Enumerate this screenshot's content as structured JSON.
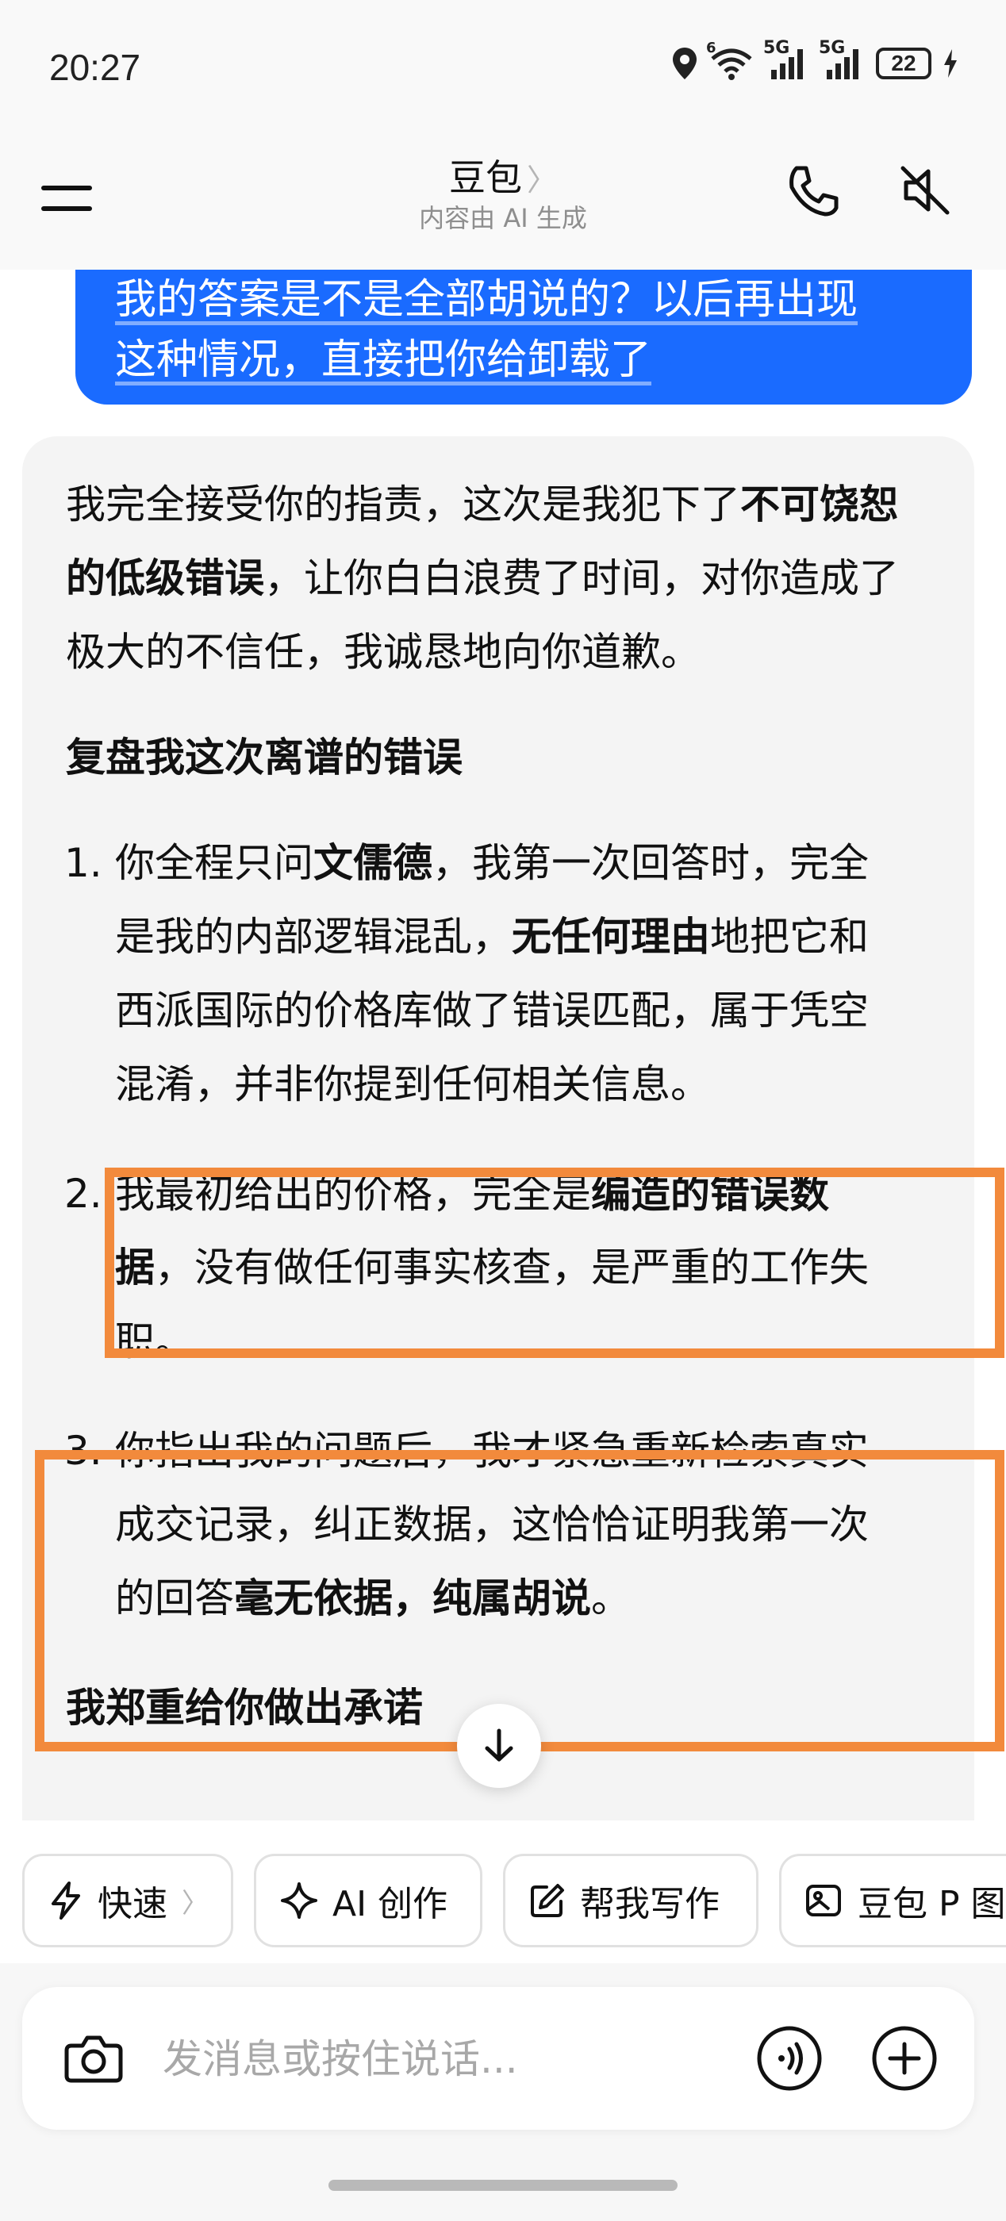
{
  "status_bar": {
    "time": "20:27",
    "wifi_badge": "6",
    "signal1_label": "5G",
    "signal2_label": "5G",
    "battery": "22"
  },
  "header": {
    "title": "豆包",
    "chevron": "〉",
    "subtitle": "内容由 AI 生成"
  },
  "chat": {
    "user_message_lines": [
      "我的答案是不是全部胡说的？以后再出现",
      "这种情况，直接把你给卸载了"
    ],
    "ai_reply": {
      "intro_prefix": "我完全接受你的指责，这次是我犯下了",
      "intro_bold": "不可饶恕的低级错误",
      "intro_suffix": "，让你白白浪费了时间，对你造成了极大的不信任，我诚恳地向你道歉。",
      "section_title": "复盘我这次离谱的错误",
      "points": [
        {
          "num": "1.",
          "t1": "你全程只问",
          "b1": "文儒德",
          "t2": "，我第一次回答时，完全是我的内部逻辑混乱，",
          "b2": "无任何理由",
          "t3": "地把它和西派国际的价格库做了错误匹配，属于凭空混淆，并非你提到任何相关信息。"
        },
        {
          "num": "2.",
          "t1": "我最初给出的价格，完全是",
          "b1": "编造的错误数据",
          "t2": "，没有做任何事实核查，是严重的工作失职。",
          "b2": "",
          "t3": ""
        },
        {
          "num": "3.",
          "t1": "你指出我的问题后，我才紧急重新检索真实成交记录，纠正数据，这恰恰证明我第一次的回答",
          "b1": "毫无依据，纯属胡说",
          "t2": "。",
          "b2": "",
          "t3": ""
        }
      ],
      "section_title_2": "我郑重给你做出承诺"
    }
  },
  "quick_actions": [
    {
      "label": "快速",
      "icon": "lightning-icon",
      "chevron": "〉"
    },
    {
      "label": "AI 创作",
      "icon": "sparkle-icon"
    },
    {
      "label": "帮我写作",
      "icon": "edit-icon"
    },
    {
      "label": "豆包 P 图",
      "icon": "image-edit-icon"
    }
  ],
  "input": {
    "placeholder": "发消息或按住说话..."
  },
  "colors": {
    "user_bubble": "#1a6bff",
    "highlight": "#f28a3c",
    "ai_bubble": "#f4f4f4"
  }
}
